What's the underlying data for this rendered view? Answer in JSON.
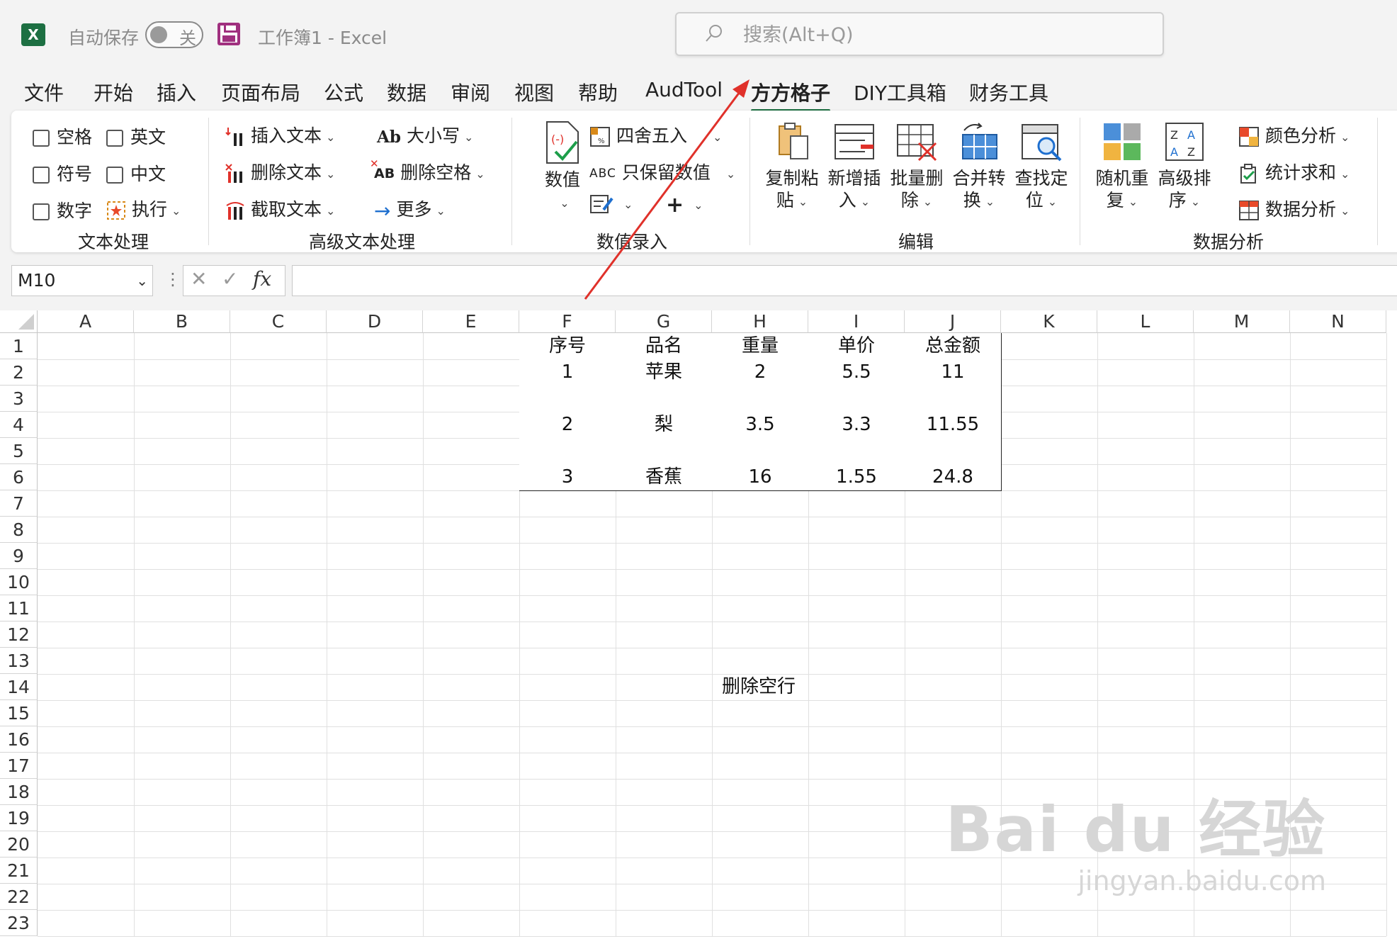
{
  "titlebar": {
    "app_icon": "X",
    "autosave_label": "自动保存",
    "autosave_state": "关",
    "doc_title": "工作簿1  -  Excel",
    "search_placeholder": "搜索(Alt+Q)"
  },
  "menu": {
    "tabs": [
      {
        "label": "文件"
      },
      {
        "label": "开始"
      },
      {
        "label": "插入"
      },
      {
        "label": "页面布局"
      },
      {
        "label": "公式"
      },
      {
        "label": "数据"
      },
      {
        "label": "审阅"
      },
      {
        "label": "视图"
      },
      {
        "label": "帮助"
      },
      {
        "label": "AudTool"
      },
      {
        "label": "方方格子"
      },
      {
        "label": "DIY工具箱"
      },
      {
        "label": "财务工具"
      }
    ],
    "active_tab": "方方格子"
  },
  "ribbon": {
    "text_processing": {
      "group_label": "文本处理",
      "options": [
        {
          "label": "空格"
        },
        {
          "label": "英文"
        },
        {
          "label": "符号"
        },
        {
          "label": "中文"
        },
        {
          "label": "数字"
        }
      ],
      "execute_label": "执行"
    },
    "advanced_text": {
      "group_label": "高级文本处理",
      "insert_text": "插入文本",
      "delete_text": "删除文本",
      "extract_text": "截取文本",
      "case": "大小写",
      "case_icon": "Ab",
      "delete_space": "删除空格",
      "delete_space_icon": "AB",
      "more": "更多"
    },
    "numeric_entry": {
      "group_label": "数值录入",
      "numeric": "数值",
      "round": "四舍五入",
      "keep_numeric": "只保留数值",
      "keep_numeric_icon": "ABC"
    },
    "edit": {
      "group_label": "编辑",
      "buttons": [
        {
          "line1": "复制粘",
          "line2": "贴"
        },
        {
          "line1": "新增插",
          "line2": "入"
        },
        {
          "line1": "批量删",
          "line2": "除"
        },
        {
          "line1": "合并转",
          "line2": "换"
        },
        {
          "line1": "查找定",
          "line2": "位"
        }
      ]
    },
    "data_analysis": {
      "group_label": "数据分析",
      "random_repeat": {
        "line1": "随机重",
        "line2": "复"
      },
      "advanced_sort": {
        "line1": "高级排",
        "line2": "序"
      },
      "advanced_sort_icon": "ZA AZ",
      "color_analysis": "颜色分析",
      "stat_sum": "统计求和",
      "data_analysis": "数据分析"
    }
  },
  "formula_bar": {
    "name_box": "M10",
    "fx": "fx",
    "formula": ""
  },
  "sheet": {
    "columns": [
      "A",
      "B",
      "C",
      "D",
      "E",
      "F",
      "G",
      "H",
      "I",
      "J",
      "K",
      "L",
      "M",
      "N"
    ],
    "rows": [
      "1",
      "2",
      "3",
      "4",
      "5",
      "6",
      "7",
      "8",
      "9",
      "10",
      "11",
      "12",
      "13",
      "14",
      "15",
      "16",
      "17",
      "18",
      "19",
      "20",
      "21",
      "22",
      "23"
    ],
    "table": {
      "headers": [
        "序号",
        "品名",
        "重量",
        "单价",
        "总金额"
      ],
      "rows": [
        [
          "1",
          "苹果",
          "2",
          "5.5",
          "11"
        ],
        [
          "",
          "",
          "",
          "",
          ""
        ],
        [
          "2",
          "梨",
          "3.5",
          "3.3",
          "11.55"
        ],
        [
          "",
          "",
          "",
          "",
          ""
        ],
        [
          "3",
          "香蕉",
          "16",
          "1.55",
          "24.8"
        ]
      ]
    },
    "note": "删除空行"
  },
  "watermark": {
    "brand": "Bai du 经验",
    "url": "jingyan.baidu.com"
  },
  "colors": {
    "accent": "#1d6f42",
    "arrow": "#e0312a"
  }
}
